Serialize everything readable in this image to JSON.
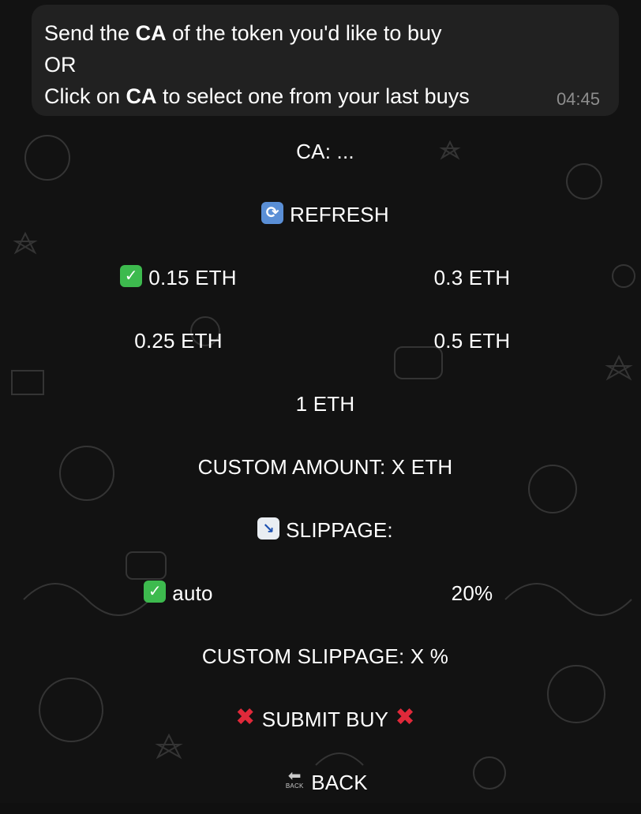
{
  "message": {
    "line1_pre": "Send the ",
    "line1_bold": "CA",
    "line1_post": " of the token you'd like to buy",
    "line2": "OR",
    "line3_pre": "Click on ",
    "line3_bold": "CA",
    "line3_post": " to select one from your last buys",
    "time": "04:45"
  },
  "keyboard": {
    "ca": "CA: ...",
    "refresh": "REFRESH",
    "amount_015": "0.15 ETH",
    "amount_03": "0.3 ETH",
    "amount_025": "0.25 ETH",
    "amount_05": "0.5 ETH",
    "amount_1": "1 ETH",
    "custom_amount": "CUSTOM AMOUNT: X ETH",
    "slippage": "SLIPPAGE:",
    "slippage_auto": "auto",
    "slippage_20": "20%",
    "custom_slippage": "CUSTOM SLIPPAGE: X %",
    "submit_buy": "SUBMIT BUY",
    "back": "BACK",
    "back_icon_text": "BACK"
  },
  "icons": {
    "check": "check-mark-icon",
    "refresh": "refresh-icon",
    "chart": "chart-decreasing-icon",
    "cross": "cross-mark-icon",
    "back": "back-arrow-icon"
  },
  "colors": {
    "background": "#121212",
    "bubble": "#212121",
    "text": "#ffffff",
    "time": "#8d8d8d",
    "check": "#3dba4e",
    "cross": "#e0293a"
  }
}
